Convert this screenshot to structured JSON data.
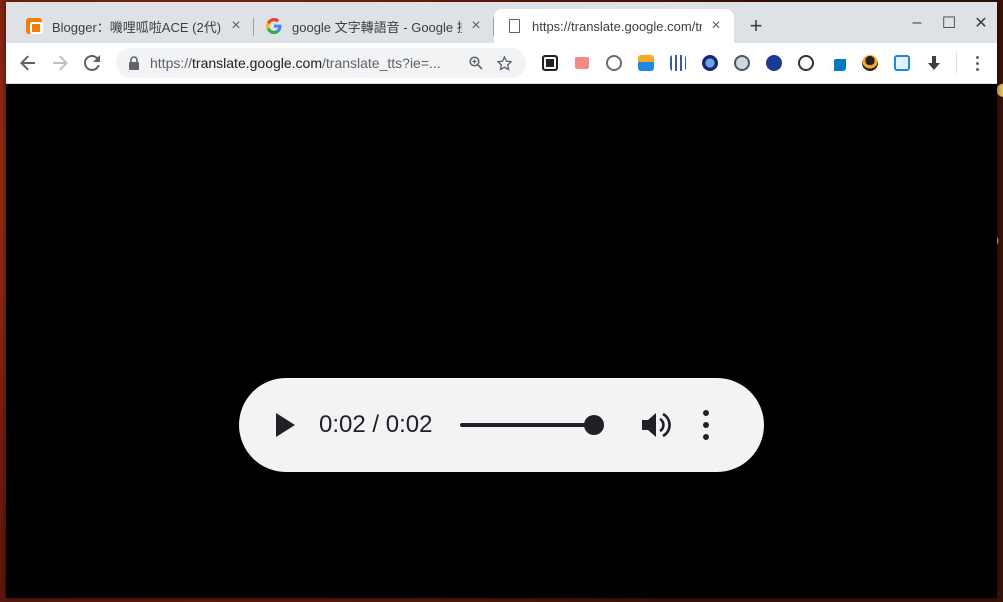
{
  "tabs": [
    {
      "title": "Blogger：嘰哩呱啦ACE (2代) - ",
      "favicon": "blogger-icon",
      "close": "×"
    },
    {
      "title": "google 文字轉語音 - Google 搜",
      "favicon": "google-icon",
      "close": "×"
    },
    {
      "title": "https://translate.google.com/tr",
      "favicon": "document-icon",
      "close": "×"
    }
  ],
  "new_tab_label": "+",
  "window_controls": {
    "minimize": "–",
    "maximize": "☐",
    "close": "✕"
  },
  "omnibox": {
    "scheme": "https://",
    "host": "translate.google.com",
    "path": "/translate_tts?ie=..."
  },
  "player": {
    "current_time": "0:02",
    "separator": " / ",
    "duration": "0:02",
    "progress": 1.0
  },
  "colors": {
    "tabstrip": "#dee1e6",
    "omnibox_bg": "#f1f3f4",
    "player_bg": "#f1f3f4",
    "content_bg": "#000000"
  }
}
